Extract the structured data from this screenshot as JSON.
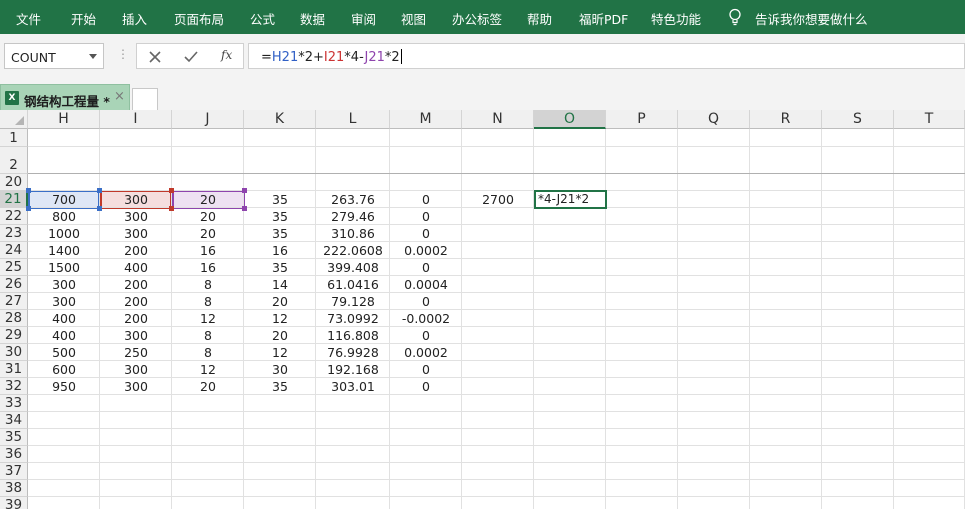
{
  "ribbon": {
    "tabs": [
      "文件",
      "开始",
      "插入",
      "页面布局",
      "公式",
      "数据",
      "审阅",
      "视图",
      "办公标签",
      "帮助",
      "福昕PDF",
      "特色功能"
    ],
    "tell_me": "告诉我你想要做什么"
  },
  "formula_bar": {
    "name_box": "COUNT",
    "fx_label": "fx",
    "formula_parts": [
      {
        "text": "=",
        "color": "default"
      },
      {
        "text": "H21",
        "color": "blue"
      },
      {
        "text": "*2+",
        "color": "default"
      },
      {
        "text": "I21",
        "color": "red"
      },
      {
        "text": "*4-",
        "color": "default"
      },
      {
        "text": "J21",
        "color": "purple"
      },
      {
        "text": "*2",
        "color": "default"
      }
    ]
  },
  "workbook_tab": {
    "icon_text": "X",
    "name": "钢结构工程量 *",
    "close": "×"
  },
  "sheet": {
    "columns": [
      "H",
      "I",
      "J",
      "K",
      "L",
      "M",
      "N",
      "O",
      "P",
      "Q",
      "R",
      "S",
      "T"
    ],
    "selected_column": "O",
    "rows": [
      "1",
      "2",
      "20",
      "21",
      "22",
      "23",
      "24",
      "25",
      "26",
      "27",
      "28",
      "29",
      "30",
      "31",
      "32",
      "33",
      "34",
      "35",
      "36",
      "37",
      "38",
      "39"
    ],
    "selected_row": "21",
    "editing_cell_text": "*4-J21*2",
    "data": [
      {
        "row": "21",
        "H": "700",
        "I": "300",
        "J": "20",
        "K": "35",
        "L": "263.76",
        "M": "0",
        "N": "2700"
      },
      {
        "row": "22",
        "H": "800",
        "I": "300",
        "J": "20",
        "K": "35",
        "L": "279.46",
        "M": "0"
      },
      {
        "row": "23",
        "H": "1000",
        "I": "300",
        "J": "20",
        "K": "35",
        "L": "310.86",
        "M": "0"
      },
      {
        "row": "24",
        "H": "1400",
        "I": "200",
        "J": "16",
        "K": "16",
        "L": "222.0608",
        "M": "0.0002"
      },
      {
        "row": "25",
        "H": "1500",
        "I": "400",
        "J": "16",
        "K": "35",
        "L": "399.408",
        "M": "0"
      },
      {
        "row": "26",
        "H": "300",
        "I": "200",
        "J": "8",
        "K": "14",
        "L": "61.0416",
        "M": "0.0004"
      },
      {
        "row": "27",
        "H": "300",
        "I": "200",
        "J": "8",
        "K": "20",
        "L": "79.128",
        "M": "0"
      },
      {
        "row": "28",
        "H": "400",
        "I": "200",
        "J": "12",
        "K": "12",
        "L": "73.0992",
        "M": "-0.0002"
      },
      {
        "row": "29",
        "H": "400",
        "I": "300",
        "J": "8",
        "K": "20",
        "L": "116.808",
        "M": "0"
      },
      {
        "row": "30",
        "H": "500",
        "I": "250",
        "J": "8",
        "K": "12",
        "L": "76.9928",
        "M": "0.0002"
      },
      {
        "row": "31",
        "H": "600",
        "I": "300",
        "J": "12",
        "K": "30",
        "L": "192.168",
        "M": "0"
      },
      {
        "row": "32",
        "H": "950",
        "I": "300",
        "J": "20",
        "K": "35",
        "L": "303.01",
        "M": "0"
      }
    ]
  },
  "colors": {
    "accent": "#217346",
    "ref_blue": "#3b6fc7",
    "ref_red": "#c0392b",
    "ref_purple": "#8e44ad"
  }
}
